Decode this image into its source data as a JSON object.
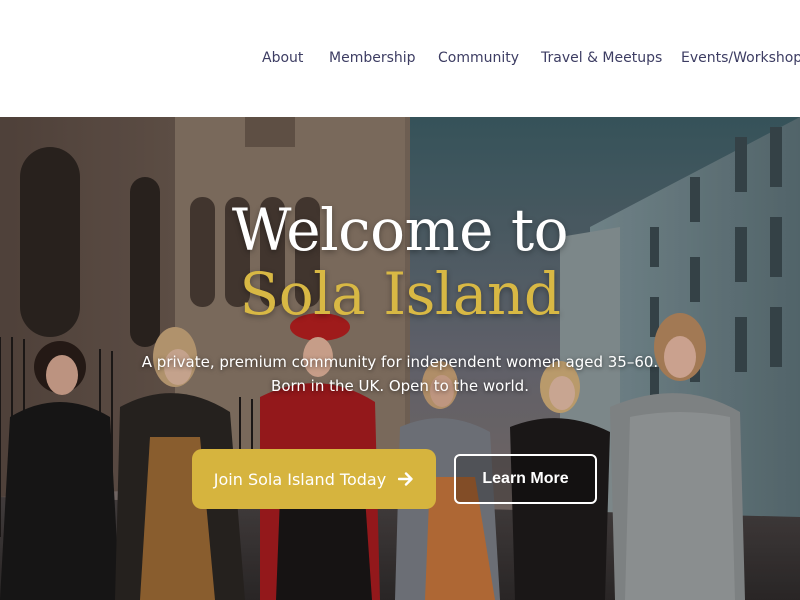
{
  "nav": {
    "items": [
      {
        "label": "About"
      },
      {
        "label": "Membership"
      },
      {
        "label": "Community"
      },
      {
        "label": "Travel & Meetups"
      },
      {
        "label": "Events/Workshops"
      }
    ]
  },
  "hero": {
    "title_line1": "Welcome to",
    "title_line2": "Sola Island",
    "subtitle_line1": "A private, premium community for independent women aged 35–60.",
    "subtitle_line2": "Born in the UK. Open to the world.",
    "primary_button": "Join Sola Island Today",
    "primary_button_icon": "arrow-right-icon",
    "secondary_button": "Learn More"
  },
  "colors": {
    "nav_text": "#3d3d63",
    "accent_gold": "#d6b43e",
    "title_gold": "#d8b844",
    "white": "#ffffff"
  }
}
